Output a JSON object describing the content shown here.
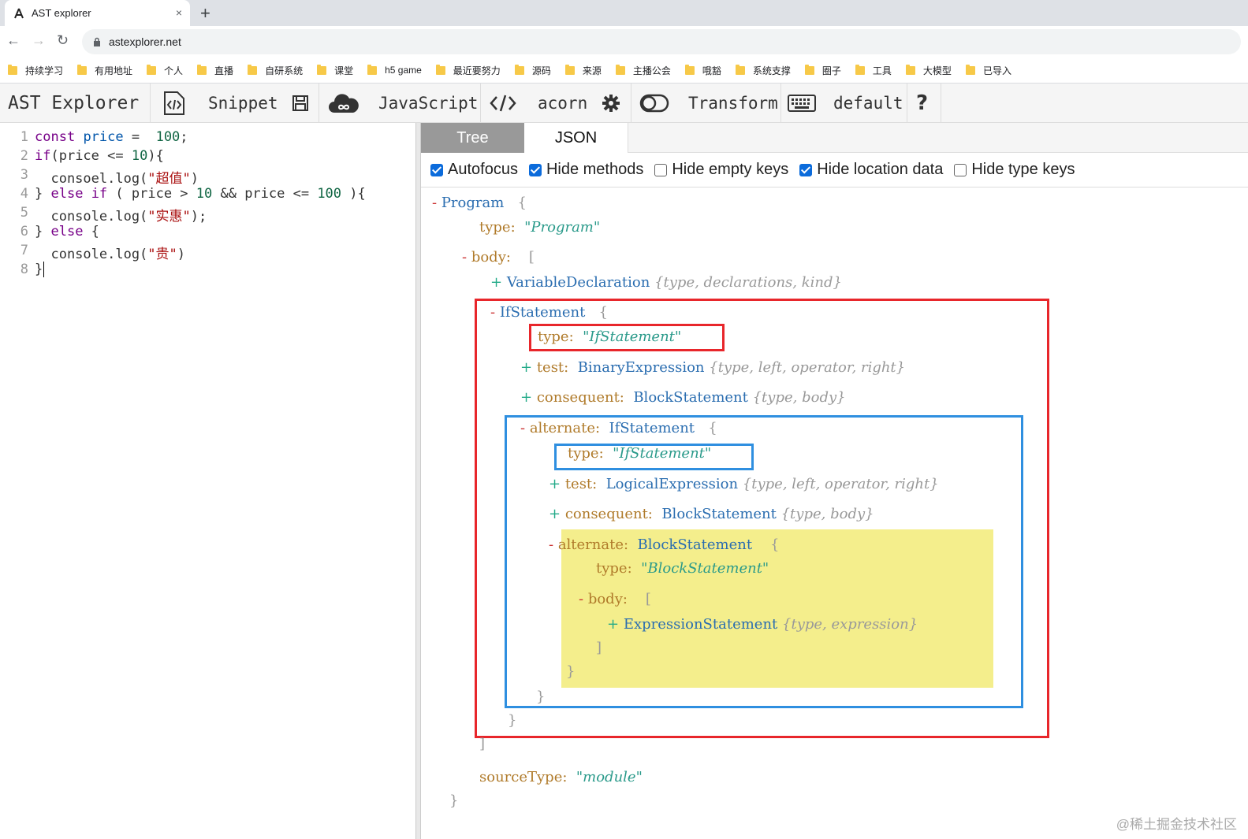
{
  "browser": {
    "tab_title": "AST explorer",
    "close_glyph": "×",
    "newtab_glyph": "+",
    "back_glyph": "←",
    "forward_glyph": "→",
    "reload_glyph": "↻",
    "url": "astexplorer.net"
  },
  "bookmarks": [
    "持续学习",
    "有用地址",
    "个人",
    "直播",
    "自研系统",
    "课堂",
    "h5 game",
    "最近要努力",
    "源码",
    "来源",
    "主播公会",
    "哦豁",
    "系统支撑",
    "圈子",
    "工具",
    "大模型",
    "已导入"
  ],
  "toolbar": {
    "app_title": "AST Explorer",
    "snippet_label": "Snippet",
    "language_label": "JavaScript",
    "parser_label": "acorn",
    "transform_label": "Transform",
    "keymap_label": "default",
    "help_label": "?"
  },
  "editor": {
    "line_numbers": [
      "1",
      "2",
      "3",
      "4",
      "5",
      "6",
      "7",
      "8"
    ]
  },
  "right_tabs": {
    "tree": "Tree",
    "json": "JSON"
  },
  "options": [
    {
      "label": "Autofocus",
      "checked": true
    },
    {
      "label": "Hide methods",
      "checked": true
    },
    {
      "label": "Hide empty keys",
      "checked": false
    },
    {
      "label": "Hide location data",
      "checked": true
    },
    {
      "label": "Hide type keys",
      "checked": false
    }
  ],
  "tree": {
    "program": "Program",
    "type_key": "type:",
    "program_type": "\"Program\"",
    "body_key": "body:",
    "vardecl": "VariableDeclaration",
    "vardecl_summary": "{type, declarations, kind}",
    "ifstmt": "IfStatement",
    "if_type_val": "\"IfStatement\"",
    "test_key": "test:",
    "binexpr": "BinaryExpression",
    "binexpr_summary": "{type, left, operator, right}",
    "consequent_key": "consequent:",
    "blockstmt": "BlockStatement",
    "block_summary": "{type, body}",
    "alternate_key": "alternate:",
    "alt_if": "IfStatement",
    "alt_if_type_val": "\"IfStatement\"",
    "logexpr": "LogicalExpression",
    "logexpr_summary": "{type, left, operator, right}",
    "blockstmt2": "BlockStatement",
    "block_summary2": "{type, body}",
    "alt_block": "BlockStatement",
    "alt_block_type_val": "\"BlockStatement\"",
    "exprstmt": "ExpressionStatement",
    "exprstmt_summary": "{type, expression}",
    "sourcetype_key": "sourceType:",
    "sourcetype_val": "\"module\""
  },
  "watermark": "@稀土掘金技术社区",
  "colors": {
    "highlight_red": "#e8262b",
    "highlight_blue": "#2f8fe0",
    "highlight_yellow": "#f4ee8c",
    "checkbox_on": "#0b6bdb"
  }
}
